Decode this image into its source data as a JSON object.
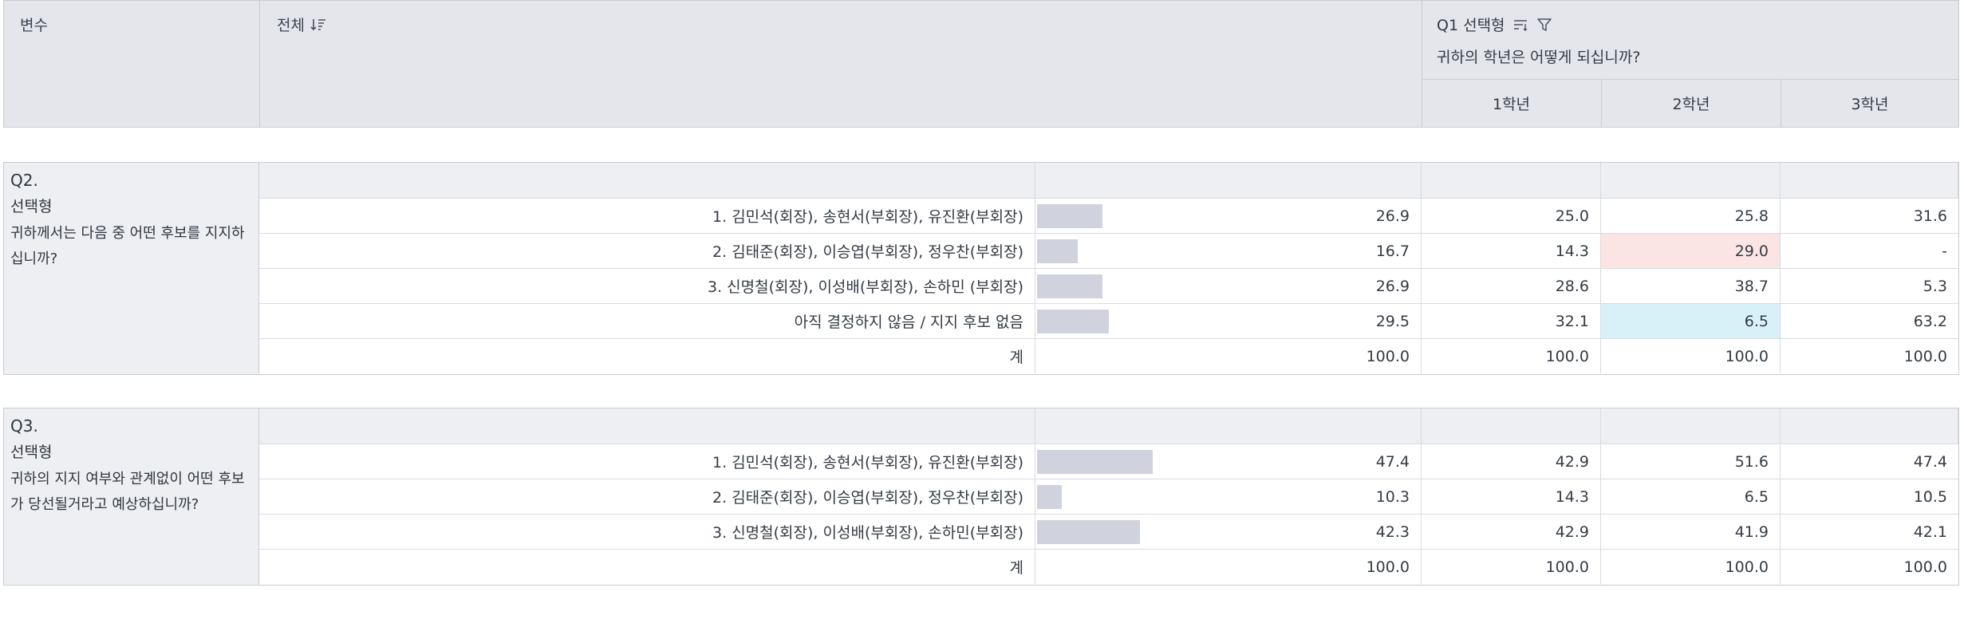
{
  "header": {
    "variable_label": "변수",
    "total_label": "전체",
    "q1_title": "Q1 선택형",
    "q1_question": "귀하의 학년은 어떻게 되십니까?",
    "grades": [
      "1학년",
      "2학년",
      "3학년"
    ]
  },
  "blocks": [
    {
      "qnum": "Q2.",
      "qtype": "선택형",
      "question": "귀하께서는 다음 중 어떤 후보를 지지하십니까?",
      "rows": [
        {
          "label": "1. 김민석(회장), 송현서(부회장), 유진환(부회장)",
          "total": "26.9",
          "g1": "25.0",
          "g2": "25.8",
          "g3": "31.6",
          "bar": 26.9
        },
        {
          "label": "2. 김태준(회장), 이승엽(부회장), 정우찬(부회장)",
          "total": "16.7",
          "g1": "14.3",
          "g2": "29.0",
          "g3": "-",
          "bar": 16.7,
          "hl_g2": "pink"
        },
        {
          "label": "3. 신명철(회장), 이성배(부회장), 손하민 (부회장)",
          "total": "26.9",
          "g1": "28.6",
          "g2": "38.7",
          "g3": "5.3",
          "bar": 26.9
        },
        {
          "label": "아직 결정하지 않음 / 지지 후보 없음",
          "total": "29.5",
          "g1": "32.1",
          "g2": "6.5",
          "g3": "63.2",
          "bar": 29.5,
          "hl_g2": "cyan"
        }
      ],
      "sum": {
        "label": "계",
        "total": "100.0",
        "g1": "100.0",
        "g2": "100.0",
        "g3": "100.0"
      }
    },
    {
      "qnum": "Q3.",
      "qtype": "선택형",
      "question": "귀하의 지지 여부와 관계없이 어떤 후보가 당선될거라고 예상하십니까?",
      "rows": [
        {
          "label": "1. 김민석(회장), 송현서(부회장), 유진환(부회장)",
          "total": "47.4",
          "g1": "42.9",
          "g2": "51.6",
          "g3": "47.4",
          "bar": 47.4
        },
        {
          "label": "2. 김태준(회장), 이승엽(부회장), 정우찬(부회장)",
          "total": "10.3",
          "g1": "14.3",
          "g2": "6.5",
          "g3": "10.5",
          "bar": 10.3
        },
        {
          "label": "3. 신명철(회장), 이성배(부회장), 손하민(부회장)",
          "total": "42.3",
          "g1": "42.9",
          "g2": "41.9",
          "g3": "42.1",
          "bar": 42.3
        }
      ],
      "sum": {
        "label": "계",
        "total": "100.0",
        "g1": "100.0",
        "g2": "100.0",
        "g3": "100.0"
      }
    }
  ],
  "colors": {
    "bar": "#d0d3de",
    "highlight_pink": "#fbe4e4",
    "highlight_cyan": "#d8f1f8"
  }
}
